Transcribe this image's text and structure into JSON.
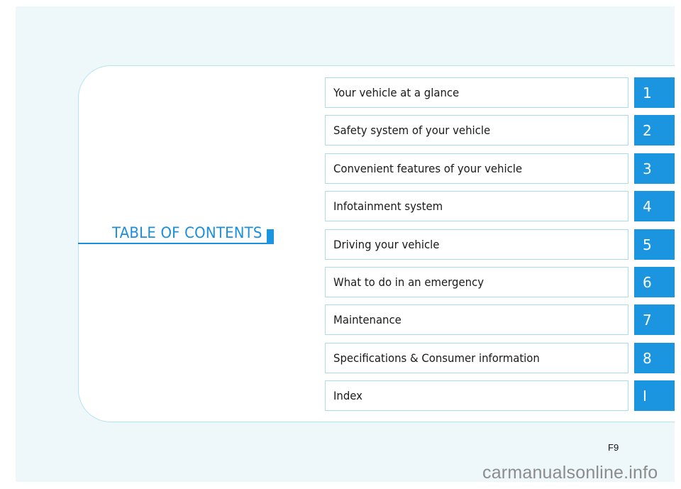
{
  "title": "TABLE OF CONTENTS",
  "colors": {
    "accent": "#1b95e0",
    "title_text": "#1b8fdc",
    "box_border": "#a9dcee",
    "page_background": "#eef8fb"
  },
  "chapters": [
    {
      "label": "Your vehicle at a glance",
      "number": "1"
    },
    {
      "label": "Safety system of your vehicle",
      "number": "2"
    },
    {
      "label": "Convenient features of your vehicle",
      "number": "3"
    },
    {
      "label": "Infotainment system",
      "number": "4"
    },
    {
      "label": "Driving your vehicle",
      "number": "5"
    },
    {
      "label": "What to do in an emergency",
      "number": "6"
    },
    {
      "label": "Maintenance",
      "number": "7"
    },
    {
      "label": "Specifications & Consumer information",
      "number": "8"
    },
    {
      "label": "Index",
      "number": "I"
    }
  ],
  "page_code": "F9",
  "watermark": "carmanualsonline.info"
}
